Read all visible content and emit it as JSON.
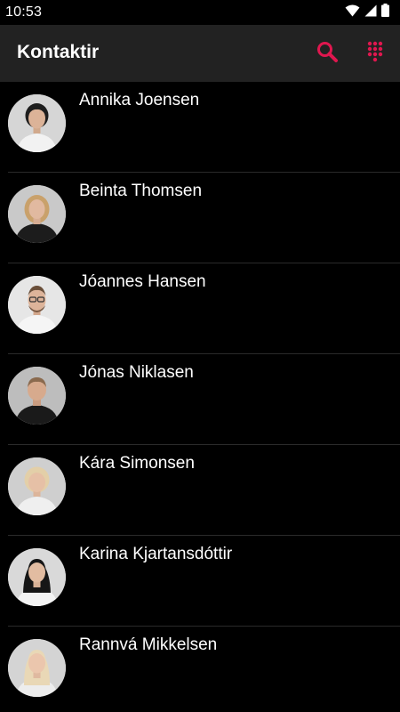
{
  "status_bar": {
    "time": "10:53",
    "icons": [
      "wifi-icon",
      "signal-icon",
      "battery-icon"
    ]
  },
  "app_bar": {
    "title": "Kontaktir",
    "actions": [
      "search-icon",
      "dialpad-icon"
    ]
  },
  "colors": {
    "accent": "#e0174f",
    "background": "#000000",
    "app_bar": "#222222",
    "divider": "#2a2a2a"
  },
  "contacts": [
    {
      "name": "Annika Joensen"
    },
    {
      "name": "Beinta Thomsen"
    },
    {
      "name": "Jóannes Hansen"
    },
    {
      "name": "Jónas Niklasen"
    },
    {
      "name": "Kára Simonsen"
    },
    {
      "name": "Karina Kjartansdóttir"
    },
    {
      "name": "Rannvá Mikkelsen"
    }
  ]
}
